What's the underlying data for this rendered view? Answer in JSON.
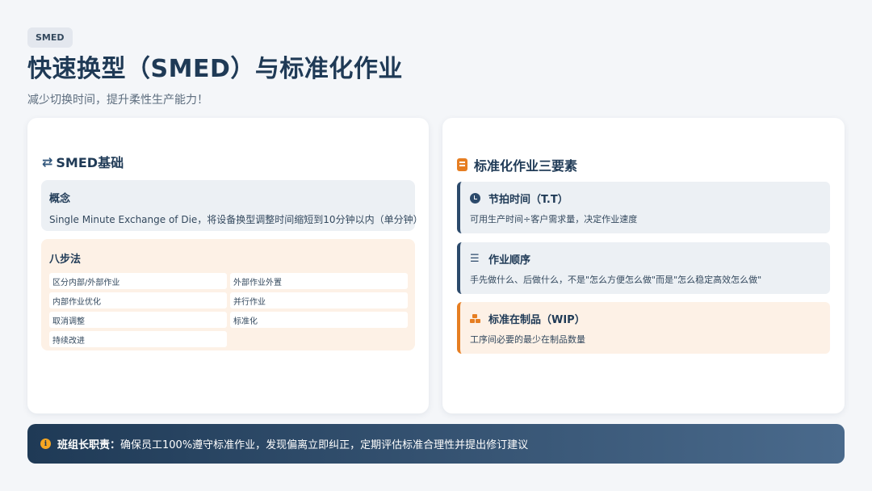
{
  "header": {
    "tag": "SMED",
    "title": "快速换型（SMED）与标准化作业",
    "subtitle": "减少切换时间，提升柔性生产能力！"
  },
  "left_card": {
    "title": "SMED基础",
    "icon": "swap-arrows-icon",
    "concept": {
      "heading": "概念",
      "text": "Single Minute Exchange of Die，将设备换型调整时间缩短到10分钟以内（单分钟）"
    },
    "steps": {
      "heading": "八步法",
      "items": [
        "区分内部/外部作业",
        "外部作业外置",
        "内部作业优化",
        "并行作业",
        "取消调整",
        "标准化",
        "持续改进"
      ]
    }
  },
  "right_card": {
    "title": "标准化作业三要素",
    "icon": "clipboard-icon",
    "elements": [
      {
        "icon": "clock-icon",
        "heading": "节拍时间（T.T）",
        "text": "可用生产时间÷客户需求量，决定作业速度"
      },
      {
        "icon": "list-ordered-icon",
        "heading": "作业顺序",
        "text": "手先做什么、后做什么，不是\"怎么方便怎么做\"而是\"怎么稳定高效怎么做\""
      },
      {
        "icon": "boxes-icon",
        "heading": "标准在制品（WIP）",
        "text": "工序间必要的最少在制品数量"
      }
    ]
  },
  "footer": {
    "icon": "info-icon",
    "label": "班组长职责：",
    "text": "确保员工100%遵守标准作业，发现偏离立即纠正，定期评估标准合理性并提出修订建议"
  },
  "colors": {
    "primary": "#1f3a56",
    "accent": "#e67e22",
    "background": "#f4f6f9"
  }
}
